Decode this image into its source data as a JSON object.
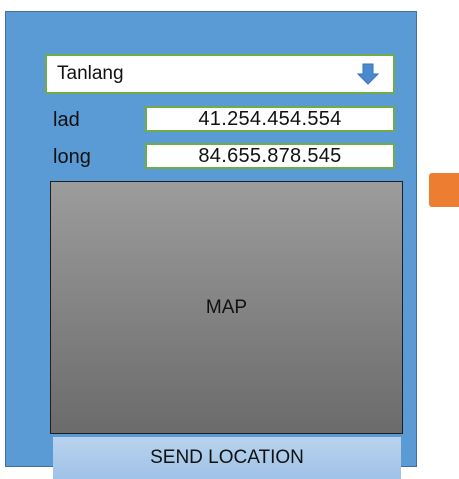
{
  "dropdown": {
    "selected": "Tanlang",
    "icon": "arrow-down-icon"
  },
  "fields": {
    "lat_label": "lad",
    "lat_value": "41.254.454.554",
    "long_label": "long",
    "long_value": "84.655.878.545"
  },
  "map": {
    "label": "MAP"
  },
  "actions": {
    "send_label": "SEND LOCATION"
  },
  "colors": {
    "panel": "#5b9bd5",
    "field_border": "#70ad47",
    "handle": "#ed7d31",
    "arrow": "#4a8ad0"
  }
}
